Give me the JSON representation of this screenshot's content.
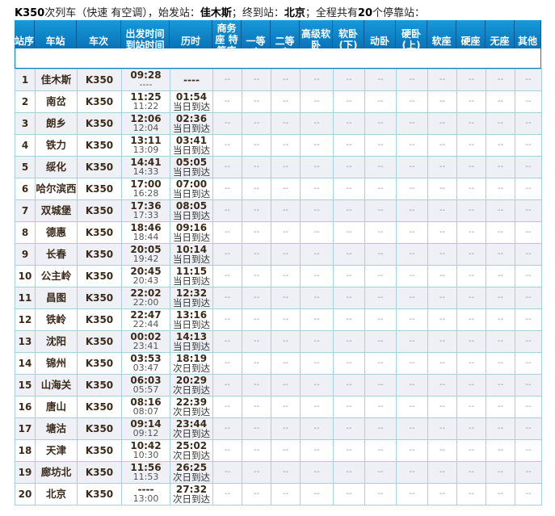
{
  "title": {
    "train": "K350",
    "mid": "次列车（快速 有空调），始发站：",
    "origin": "佳木斯",
    "sep": "；终到站：",
    "dest": "北京",
    "sep2": "；全程共有",
    "count": "20",
    "tail": "个停靠站："
  },
  "headers": [
    "站序",
    "车站",
    "车次",
    "出发时间 到站时间",
    "历时",
    "商务座 特等座",
    "一等座",
    "二等座",
    "高级软卧",
    "软卧(下)",
    "动卧",
    "硬卧(上)",
    "软座",
    "硬座",
    "无座",
    "其他"
  ],
  "empty_seat": "--",
  "rows": [
    {
      "no": "1",
      "station": "佳木斯",
      "train": "K350",
      "dep": "09:28",
      "arr": "----",
      "dur": "----",
      "day": ""
    },
    {
      "no": "2",
      "station": "南岔",
      "train": "K350",
      "dep": "11:25",
      "arr": "11:22",
      "dur": "01:54",
      "day": "当日到达"
    },
    {
      "no": "3",
      "station": "朗乡",
      "train": "K350",
      "dep": "12:06",
      "arr": "12:04",
      "dur": "02:36",
      "day": "当日到达"
    },
    {
      "no": "4",
      "station": "铁力",
      "train": "K350",
      "dep": "13:11",
      "arr": "13:09",
      "dur": "03:41",
      "day": "当日到达"
    },
    {
      "no": "5",
      "station": "绥化",
      "train": "K350",
      "dep": "14:41",
      "arr": "14:33",
      "dur": "05:05",
      "day": "当日到达"
    },
    {
      "no": "6",
      "station": "哈尔滨西",
      "train": "K350",
      "dep": "17:00",
      "arr": "16:28",
      "dur": "07:00",
      "day": "当日到达"
    },
    {
      "no": "7",
      "station": "双城堡",
      "train": "K350",
      "dep": "17:36",
      "arr": "17:33",
      "dur": "08:05",
      "day": "当日到达"
    },
    {
      "no": "8",
      "station": "德惠",
      "train": "K350",
      "dep": "18:46",
      "arr": "18:44",
      "dur": "09:16",
      "day": "当日到达"
    },
    {
      "no": "9",
      "station": "长春",
      "train": "K350",
      "dep": "20:05",
      "arr": "19:42",
      "dur": "10:14",
      "day": "当日到达"
    },
    {
      "no": "10",
      "station": "公主岭",
      "train": "K350",
      "dep": "20:45",
      "arr": "20:43",
      "dur": "11:15",
      "day": "当日到达"
    },
    {
      "no": "11",
      "station": "昌图",
      "train": "K350",
      "dep": "22:02",
      "arr": "22:00",
      "dur": "12:32",
      "day": "当日到达"
    },
    {
      "no": "12",
      "station": "铁岭",
      "train": "K350",
      "dep": "22:47",
      "arr": "22:44",
      "dur": "13:16",
      "day": "当日到达"
    },
    {
      "no": "13",
      "station": "沈阳",
      "train": "K350",
      "dep": "00:02",
      "arr": "23:41",
      "dur": "14:13",
      "day": "当日到达"
    },
    {
      "no": "14",
      "station": "锦州",
      "train": "K350",
      "dep": "03:53",
      "arr": "03:47",
      "dur": "18:19",
      "day": "次日到达"
    },
    {
      "no": "15",
      "station": "山海关",
      "train": "K350",
      "dep": "06:03",
      "arr": "05:57",
      "dur": "20:29",
      "day": "次日到达"
    },
    {
      "no": "16",
      "station": "唐山",
      "train": "K350",
      "dep": "08:16",
      "arr": "08:07",
      "dur": "22:39",
      "day": "次日到达"
    },
    {
      "no": "17",
      "station": "塘沽",
      "train": "K350",
      "dep": "09:14",
      "arr": "09:12",
      "dur": "23:44",
      "day": "次日到达"
    },
    {
      "no": "18",
      "station": "天津",
      "train": "K350",
      "dep": "10:42",
      "arr": "10:30",
      "dur": "25:02",
      "day": "次日到达"
    },
    {
      "no": "19",
      "station": "廊坊北",
      "train": "K350",
      "dep": "11:56",
      "arr": "11:53",
      "dur": "26:25",
      "day": "次日到达"
    },
    {
      "no": "20",
      "station": "北京",
      "train": "K350",
      "dep": "----",
      "arr": "13:00",
      "dur": "27:32",
      "day": "次日到达"
    }
  ]
}
